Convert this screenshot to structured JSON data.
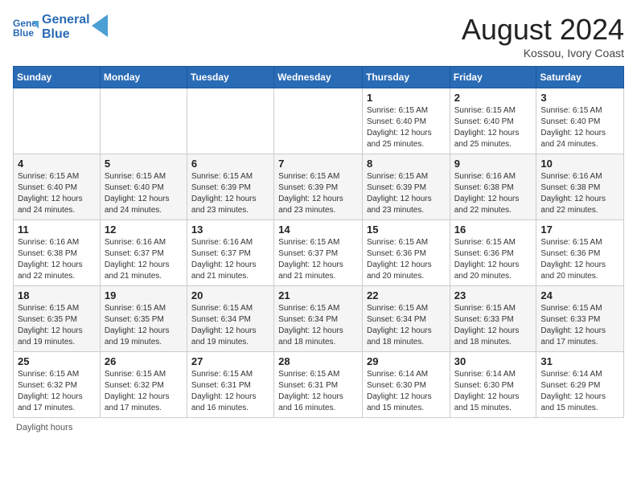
{
  "header": {
    "logo_line1": "General",
    "logo_line2": "Blue",
    "month_year": "August 2024",
    "location": "Kossou, Ivory Coast"
  },
  "days_of_week": [
    "Sunday",
    "Monday",
    "Tuesday",
    "Wednesday",
    "Thursday",
    "Friday",
    "Saturday"
  ],
  "weeks": [
    [
      {
        "day": "",
        "info": ""
      },
      {
        "day": "",
        "info": ""
      },
      {
        "day": "",
        "info": ""
      },
      {
        "day": "",
        "info": ""
      },
      {
        "day": "1",
        "info": "Sunrise: 6:15 AM\nSunset: 6:40 PM\nDaylight: 12 hours\nand 25 minutes."
      },
      {
        "day": "2",
        "info": "Sunrise: 6:15 AM\nSunset: 6:40 PM\nDaylight: 12 hours\nand 25 minutes."
      },
      {
        "day": "3",
        "info": "Sunrise: 6:15 AM\nSunset: 6:40 PM\nDaylight: 12 hours\nand 24 minutes."
      }
    ],
    [
      {
        "day": "4",
        "info": "Sunrise: 6:15 AM\nSunset: 6:40 PM\nDaylight: 12 hours\nand 24 minutes."
      },
      {
        "day": "5",
        "info": "Sunrise: 6:15 AM\nSunset: 6:40 PM\nDaylight: 12 hours\nand 24 minutes."
      },
      {
        "day": "6",
        "info": "Sunrise: 6:15 AM\nSunset: 6:39 PM\nDaylight: 12 hours\nand 23 minutes."
      },
      {
        "day": "7",
        "info": "Sunrise: 6:15 AM\nSunset: 6:39 PM\nDaylight: 12 hours\nand 23 minutes."
      },
      {
        "day": "8",
        "info": "Sunrise: 6:15 AM\nSunset: 6:39 PM\nDaylight: 12 hours\nand 23 minutes."
      },
      {
        "day": "9",
        "info": "Sunrise: 6:16 AM\nSunset: 6:38 PM\nDaylight: 12 hours\nand 22 minutes."
      },
      {
        "day": "10",
        "info": "Sunrise: 6:16 AM\nSunset: 6:38 PM\nDaylight: 12 hours\nand 22 minutes."
      }
    ],
    [
      {
        "day": "11",
        "info": "Sunrise: 6:16 AM\nSunset: 6:38 PM\nDaylight: 12 hours\nand 22 minutes."
      },
      {
        "day": "12",
        "info": "Sunrise: 6:16 AM\nSunset: 6:37 PM\nDaylight: 12 hours\nand 21 minutes."
      },
      {
        "day": "13",
        "info": "Sunrise: 6:16 AM\nSunset: 6:37 PM\nDaylight: 12 hours\nand 21 minutes."
      },
      {
        "day": "14",
        "info": "Sunrise: 6:15 AM\nSunset: 6:37 PM\nDaylight: 12 hours\nand 21 minutes."
      },
      {
        "day": "15",
        "info": "Sunrise: 6:15 AM\nSunset: 6:36 PM\nDaylight: 12 hours\nand 20 minutes."
      },
      {
        "day": "16",
        "info": "Sunrise: 6:15 AM\nSunset: 6:36 PM\nDaylight: 12 hours\nand 20 minutes."
      },
      {
        "day": "17",
        "info": "Sunrise: 6:15 AM\nSunset: 6:36 PM\nDaylight: 12 hours\nand 20 minutes."
      }
    ],
    [
      {
        "day": "18",
        "info": "Sunrise: 6:15 AM\nSunset: 6:35 PM\nDaylight: 12 hours\nand 19 minutes."
      },
      {
        "day": "19",
        "info": "Sunrise: 6:15 AM\nSunset: 6:35 PM\nDaylight: 12 hours\nand 19 minutes."
      },
      {
        "day": "20",
        "info": "Sunrise: 6:15 AM\nSunset: 6:34 PM\nDaylight: 12 hours\nand 19 minutes."
      },
      {
        "day": "21",
        "info": "Sunrise: 6:15 AM\nSunset: 6:34 PM\nDaylight: 12 hours\nand 18 minutes."
      },
      {
        "day": "22",
        "info": "Sunrise: 6:15 AM\nSunset: 6:34 PM\nDaylight: 12 hours\nand 18 minutes."
      },
      {
        "day": "23",
        "info": "Sunrise: 6:15 AM\nSunset: 6:33 PM\nDaylight: 12 hours\nand 18 minutes."
      },
      {
        "day": "24",
        "info": "Sunrise: 6:15 AM\nSunset: 6:33 PM\nDaylight: 12 hours\nand 17 minutes."
      }
    ],
    [
      {
        "day": "25",
        "info": "Sunrise: 6:15 AM\nSunset: 6:32 PM\nDaylight: 12 hours\nand 17 minutes."
      },
      {
        "day": "26",
        "info": "Sunrise: 6:15 AM\nSunset: 6:32 PM\nDaylight: 12 hours\nand 17 minutes."
      },
      {
        "day": "27",
        "info": "Sunrise: 6:15 AM\nSunset: 6:31 PM\nDaylight: 12 hours\nand 16 minutes."
      },
      {
        "day": "28",
        "info": "Sunrise: 6:15 AM\nSunset: 6:31 PM\nDaylight: 12 hours\nand 16 minutes."
      },
      {
        "day": "29",
        "info": "Sunrise: 6:14 AM\nSunset: 6:30 PM\nDaylight: 12 hours\nand 15 minutes."
      },
      {
        "day": "30",
        "info": "Sunrise: 6:14 AM\nSunset: 6:30 PM\nDaylight: 12 hours\nand 15 minutes."
      },
      {
        "day": "31",
        "info": "Sunrise: 6:14 AM\nSunset: 6:29 PM\nDaylight: 12 hours\nand 15 minutes."
      }
    ]
  ],
  "footer_note": "Daylight hours"
}
